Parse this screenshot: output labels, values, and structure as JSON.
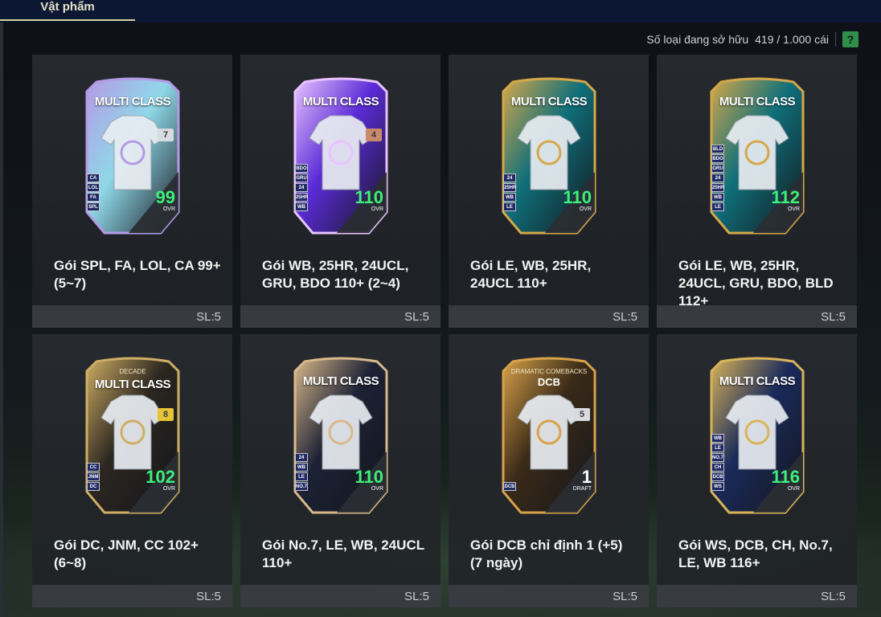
{
  "tabs": {
    "active_label": "Vật phẩm"
  },
  "ownership": {
    "label": "Số loại đang sở hữu",
    "value": "419 / 1.000 cái",
    "help_label": "?"
  },
  "items": [
    {
      "name": "Gói SPL, FA, LOL, CA 99+ (5~7)",
      "qty": "SL:5",
      "card_title": "MULTI CLASS",
      "ovr": "99",
      "ovr_label": "OVR",
      "count": "7",
      "badges": [
        "CA",
        "LOL",
        "FA",
        "SPL"
      ],
      "theme": "#8fd8e8",
      "accent": "#b59ae6"
    },
    {
      "name": "Gói WB, 25HR, 24UCL, GRU, BDO 110+ (2~4)",
      "qty": "SL:5",
      "card_title": "MULTI CLASS",
      "ovr": "110",
      "ovr_label": "OVR",
      "count": "4",
      "badges": [
        "BDO",
        "GRU",
        "24",
        "25HR",
        "WB"
      ],
      "theme": "#5a2bd6",
      "accent": "#e9c3ff"
    },
    {
      "name": "Gói LE, WB, 25HR, 24UCL 110+",
      "qty": "SL:5",
      "card_title": "MULTI CLASS",
      "ovr": "110",
      "ovr_label": "OVR",
      "count": "",
      "badges": [
        "24",
        "25HR",
        "WB",
        "LE"
      ],
      "theme": "#0f6f7a",
      "accent": "#d5a84a"
    },
    {
      "name": "Gói LE, WB, 25HR, 24UCL, GRU, BDO, BLD 112+",
      "qty": "SL:5",
      "card_title": "MULTI CLASS",
      "ovr": "112",
      "ovr_label": "OVR",
      "count": "",
      "badges": [
        "BLD",
        "BDO",
        "GRU",
        "24",
        "25HR",
        "WB",
        "LE"
      ],
      "theme": "#0f6f7a",
      "accent": "#d5a84a"
    },
    {
      "name": "Gói DC, JNM, CC 102+ (6~8)",
      "qty": "SL:5",
      "card_title": "MULTI CLASS",
      "card_sub": "DECADE",
      "ovr": "102",
      "ovr_label": "OVR",
      "count": "8",
      "badges": [
        "CC",
        "JNM",
        "DC"
      ],
      "theme": "#2b2620",
      "accent": "#cfae64"
    },
    {
      "name": "Gói No.7, LE, WB, 24UCL 110+",
      "qty": "SL:5",
      "card_title": "MULTI CLASS",
      "ovr": "110",
      "ovr_label": "OVR",
      "count": "",
      "badges": [
        "24",
        "WB",
        "LE",
        "NO.7"
      ],
      "theme": "#1c2135",
      "accent": "#d9b98a"
    },
    {
      "name": "Gói DCB chỉ định 1 (+5) (7 ngày)",
      "qty": "SL:5",
      "card_title": "DCB",
      "card_sub": "DRAMATIC COMEBACKS",
      "ovr": "1",
      "ovr_label": "DRAFT",
      "count": "5",
      "badges": [
        "DCB"
      ],
      "theme": "#3a2a18",
      "accent": "#d8a24a"
    },
    {
      "name": "Gói WS, DCB, CH, No.7, LE, WB 116+",
      "qty": "SL:5",
      "card_title": "MULTI CLASS",
      "ovr": "116",
      "ovr_label": "OVR",
      "count": "",
      "badges": [
        "WB",
        "LE",
        "NO.7",
        "CH",
        "DCB",
        "WS"
      ],
      "theme": "#1a2a5a",
      "accent": "#d9b45a"
    }
  ]
}
